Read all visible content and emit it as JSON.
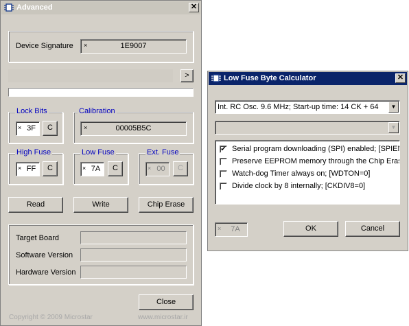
{
  "advanced": {
    "title": "Advanced",
    "close_glyph": "✕",
    "device_signature": {
      "label": "Device Signature",
      "marker": "×",
      "value": "1E9007"
    },
    "next_button": ">",
    "lock_bits": {
      "legend": "Lock Bits",
      "marker": "×",
      "value": "3F",
      "button": "C"
    },
    "calibration": {
      "legend": "Calibration",
      "marker": "×",
      "value": "00005B5C"
    },
    "high_fuse": {
      "legend": "High Fuse",
      "marker": "×",
      "value": "FF",
      "button": "C"
    },
    "low_fuse": {
      "legend": "Low Fuse",
      "marker": "×",
      "value": "7A",
      "button": "C"
    },
    "ext_fuse": {
      "legend": "Ext. Fuse",
      "marker": "×",
      "value": "00",
      "button": "C"
    },
    "buttons": {
      "read": "Read",
      "write": "Write",
      "chip_erase": "Chip Erase",
      "close": "Close"
    },
    "info": {
      "target_board": "Target Board",
      "software_version": "Software Version",
      "hardware_version": "Hardware Version"
    },
    "footer": {
      "copyright": "Copyright © 2009 Microstar",
      "website": "www.microstar.ir"
    }
  },
  "calculator": {
    "title": "Low Fuse Byte Calculator",
    "close_glyph": "✕",
    "oscillator_select": "Int. RC Osc. 9.6 MHz; Start-up time: 14 CK + 64",
    "secondary_select": "",
    "options": [
      {
        "label": "Serial program downloading (SPI) enabled; [SPIEN=",
        "checked": true
      },
      {
        "label": "Preserve EEPROM memory through the Chip Erase",
        "checked": false
      },
      {
        "label": "Watch-dog Timer always on; [WDTON=0]",
        "checked": false
      },
      {
        "label": "Divide clock by 8 internally; [CKDIV8=0]",
        "checked": false
      }
    ],
    "result": {
      "marker": "×",
      "value": "7A"
    },
    "buttons": {
      "ok": "OK",
      "cancel": "Cancel"
    }
  }
}
